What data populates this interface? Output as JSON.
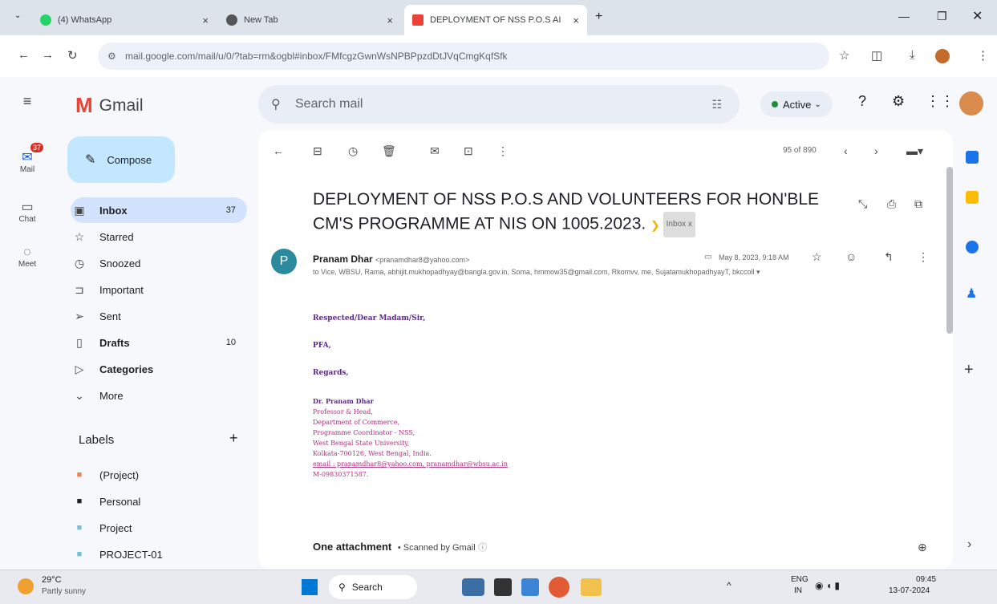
{
  "browser": {
    "tabs": [
      {
        "label": "(4) WhatsApp",
        "icon": "whatsapp-icon",
        "active": false
      },
      {
        "label": "New Tab",
        "icon": "chrome-icon",
        "active": false
      },
      {
        "label": "DEPLOYMENT OF NSS P.O.S AI",
        "icon": "gmail-icon",
        "active": true
      }
    ],
    "url": "mail.google.com/mail/u/0/?tab=rm&ogbl#inbox/FMfcgzGwnWsNPBPpzdDtJVqCmgKqfSfk"
  },
  "gmail": {
    "app_name": "Gmail",
    "search_placeholder": "Search mail",
    "status": "Active",
    "compose": "Compose",
    "rail": {
      "mail": "Mail",
      "mail_badge": "37",
      "chat": "Chat",
      "meet": "Meet"
    },
    "nav": [
      {
        "label": "Inbox",
        "count": "37",
        "icon": "inbox-icon",
        "bold": true
      },
      {
        "label": "Starred",
        "count": "",
        "icon": "star-icon",
        "bold": false
      },
      {
        "label": "Snoozed",
        "count": "",
        "icon": "clock-icon",
        "bold": false
      },
      {
        "label": "Important",
        "count": "",
        "icon": "important-icon",
        "bold": false
      },
      {
        "label": "Sent",
        "count": "",
        "icon": "send-icon",
        "bold": false
      },
      {
        "label": "Drafts",
        "count": "10",
        "icon": "draft-icon",
        "bold": true
      },
      {
        "label": "Categories",
        "count": "",
        "icon": "label-icon",
        "bold": true
      },
      {
        "label": "More",
        "count": "",
        "icon": "chevron-down-icon",
        "bold": false
      }
    ],
    "labels_heading": "Labels",
    "labels": [
      {
        "label": "(Project)",
        "color": "#f4804a"
      },
      {
        "label": "Personal",
        "color": "#202124"
      },
      {
        "label": "Project",
        "color": "#73c0d2"
      },
      {
        "label": "PROJECT-01",
        "color": "#73c0d2"
      }
    ],
    "pager": "95 of 890"
  },
  "email": {
    "subject": "DEPLOYMENT OF NSS P.O.S AND VOLUNTEERS FOR HON'BLE CM'S PROGRAMME AT NIS ON 1005.2023.",
    "label_chip": "Inbox x",
    "sender_initial": "P",
    "sender_name": "Pranam Dhar",
    "sender_email": "<pranamdhar8@yahoo.com>",
    "date": "May 8, 2023, 9:18 AM",
    "recipients": "to Vice, WBSU, Rama, abhijit.mukhopadhyay@bangla.gov.in, Soma, hmmow35@gmail.com, Rkomvv, me, SujatamukhopadhyayT, bkccoll",
    "greeting": "Respected/Dear Madam/Sir,",
    "pfa": "PFA,",
    "regards": "Regards,",
    "signature": [
      "Dr. Pranam Dhar",
      "Professor & Head,",
      "Department of Commerce,",
      "Programme Coordinator - NSS,",
      "West Bengal State University,",
      "Kolkata-700126, West Bengal, India.",
      "email : pranamdhar8@yahoo.com, pranamdhar@wbsu.ac.in",
      "M-09830371587."
    ],
    "attachment_title": "One attachment",
    "attachment_sub": "• Scanned by Gmail"
  },
  "taskbar": {
    "temp": "29°C",
    "weather": "Partly sunny",
    "search": "Search",
    "lang": "ENG",
    "region": "IN",
    "time": "09:45",
    "date": "13-07-2024"
  }
}
